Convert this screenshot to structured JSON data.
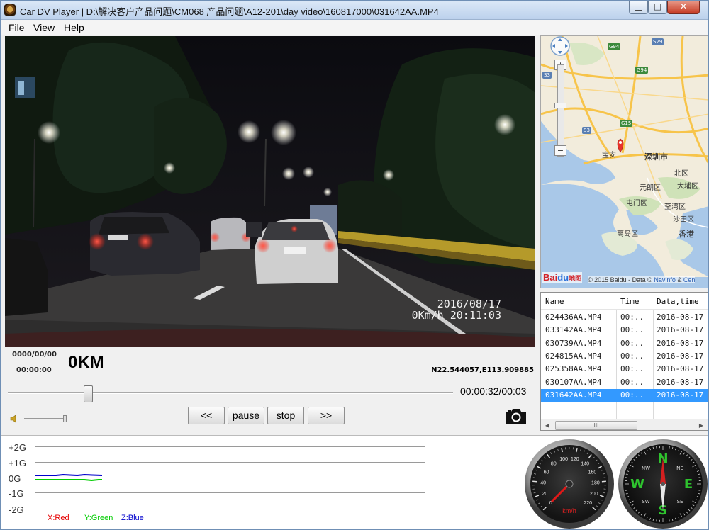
{
  "window": {
    "title": "Car DV Player | D:\\解决客户产品问题\\CM068 产品问题\\A12-201\\day video\\160817000\\031642AA.MP4",
    "min_label": "▁",
    "max_label": "□",
    "close_label": "✕"
  },
  "menu": [
    "File",
    "View",
    "Help"
  ],
  "video": {
    "osd_date": "2016/08/17",
    "osd_speed_time": "0Km/h 20:11:03"
  },
  "info": {
    "date": "0000/00/00",
    "time": "00:00:00",
    "distance": "0KM",
    "coordinates": "N22.544057,E113.909885"
  },
  "playback": {
    "time_readout": "00:00:32/00:03",
    "seek_progress": 0.18
  },
  "controls": {
    "prev": "<<",
    "pause": "pause",
    "stop": "stop",
    "next": ">>"
  },
  "map": {
    "labels": [
      "深圳市",
      "宝安",
      "北区",
      "大埔区",
      "元朗区",
      "屯门区",
      "荃湾区",
      "沙田区",
      "离岛区",
      "香港"
    ],
    "highways": [
      "G94",
      "S29",
      "G94",
      "S3",
      "S3",
      "G15"
    ],
    "zoom_in": "+",
    "zoom_out": "−",
    "logo_red": "Bai",
    "logo_blue": "du",
    "logo_suffix": "地图",
    "copyright": "© 2015 Baidu - Data ©",
    "copyright_link1": "Navinfo",
    "copyright_and": " & ",
    "copyright_link2": "Cen"
  },
  "file_list": {
    "columns": [
      "Name",
      "Time",
      "Data,time"
    ],
    "rows": [
      [
        "024436AA.MP4",
        "00:..",
        "2016-08-17"
      ],
      [
        "033142AA.MP4",
        "00:..",
        "2016-08-17"
      ],
      [
        "030739AA.MP4",
        "00:..",
        "2016-08-17"
      ],
      [
        "024815AA.MP4",
        "00:..",
        "2016-08-17"
      ],
      [
        "025358AA.MP4",
        "00:..",
        "2016-08-17"
      ],
      [
        "030107AA.MP4",
        "00:..",
        "2016-08-17"
      ],
      [
        "031642AA.MP4",
        "00:..",
        "2016-08-17"
      ]
    ],
    "selected_index": 6,
    "scroll_thumb": "III"
  },
  "gsensor": {
    "labels": [
      "+2G",
      "+1G",
      "0G",
      "-1G",
      "-2G"
    ],
    "legend_x": "X:Red",
    "legend_y": "Y:Green",
    "legend_z": "Z:Blue",
    "colors": {
      "x": "#e60000",
      "y": "#00cc00",
      "z": "#0000cc"
    }
  },
  "speedometer": {
    "ticks": [
      "0",
      "20",
      "40",
      "60",
      "80",
      "100",
      "120",
      "140",
      "160",
      "180",
      "200",
      "220"
    ],
    "unit": "km/h",
    "speed": 0
  },
  "compass": {
    "letters": [
      "N",
      "E",
      "S",
      "W"
    ],
    "sub_letters": [
      "NE",
      "SE",
      "SW",
      "NW"
    ]
  },
  "icons": {
    "camera": "camera-icon",
    "volume": "speaker-icon",
    "pan": "pan-icon"
  }
}
